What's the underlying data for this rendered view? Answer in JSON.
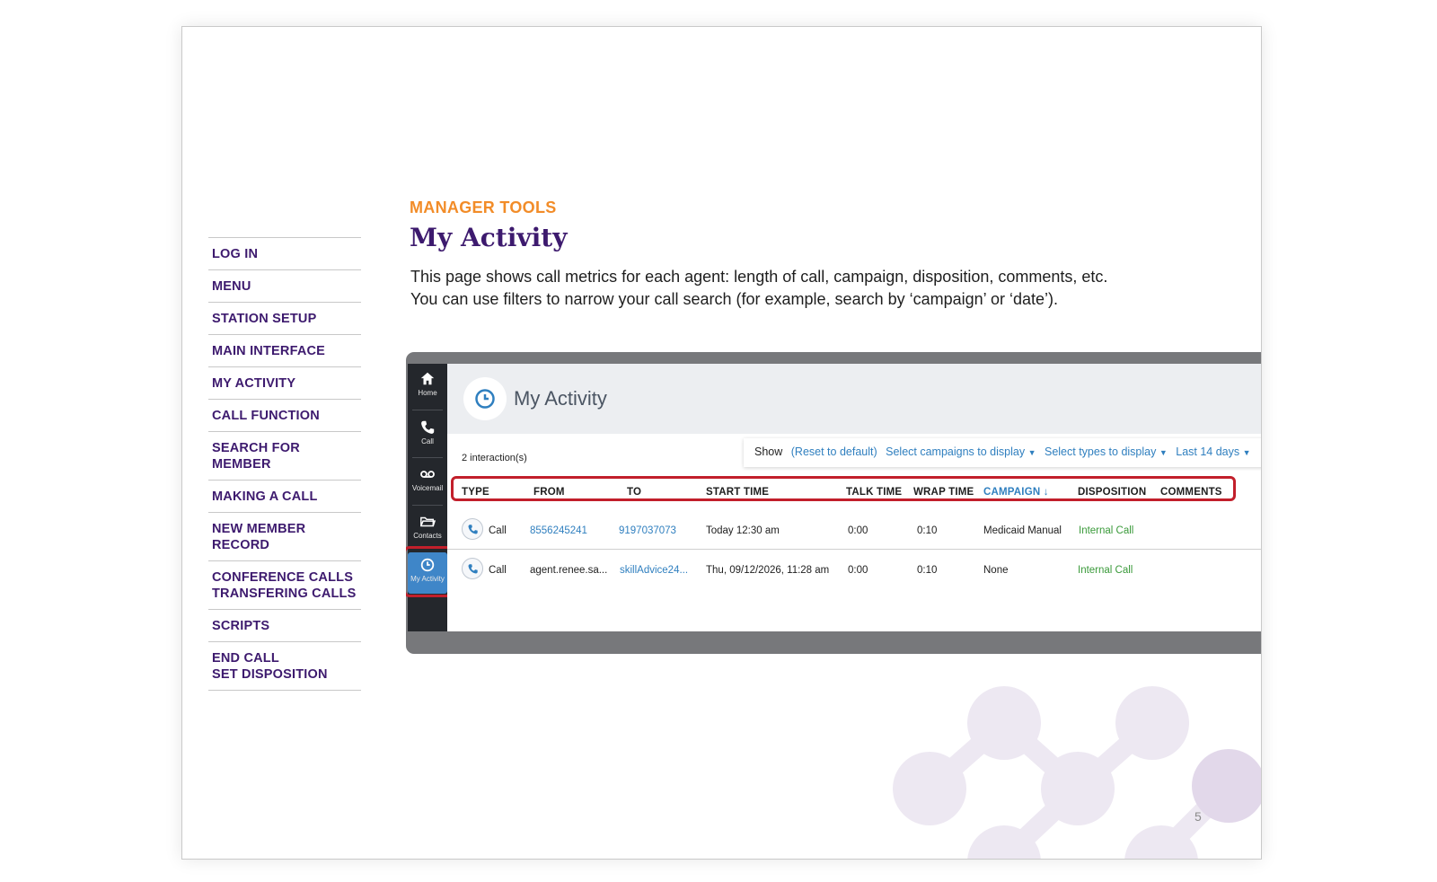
{
  "nav": {
    "items": [
      "LOG IN",
      "MENU",
      "STATION SETUP",
      "MAIN INTERFACE",
      "MY ACTIVITY",
      "CALL FUNCTION",
      "SEARCH FOR MEMBER",
      "MAKING A CALL",
      "NEW MEMBER RECORD",
      "CONFERENCE CALLS\nTRANSFERING CALLS",
      "SCRIPTS",
      "END CALL\nSET DISPOSITION"
    ]
  },
  "header": {
    "kicker": "MANAGER TOOLS",
    "title": "My Activity",
    "desc_line1": "This page shows call metrics for each agent: length of call, campaign, disposition, comments, etc.",
    "desc_line2": "You can use filters to narrow your call search (for example, search by ‘campaign’ or ‘date’)."
  },
  "app": {
    "rail": [
      {
        "label": "Home",
        "icon": "home-icon"
      },
      {
        "label": "Call",
        "icon": "phone-icon"
      },
      {
        "label": "Voicemail",
        "icon": "voicemail-icon"
      },
      {
        "label": "Contacts",
        "icon": "folder-icon"
      },
      {
        "label": "My Activity",
        "icon": "clock-icon",
        "active": true
      }
    ],
    "title": "My Activity",
    "filters": {
      "show": "Show",
      "reset": "(Reset to default)",
      "campaigns": "Select campaigns to display",
      "types": "Select types to display",
      "range": "Last 14 days"
    },
    "count": "2 interaction(s)",
    "columns": [
      "TYPE",
      "FROM",
      "TO",
      "START TIME",
      "TALK TIME",
      "WRAP TIME",
      "CAMPAIGN ↓",
      "DISPOSITION",
      "COMMENTS"
    ],
    "rows": [
      {
        "type": "Call",
        "from": "8556245241",
        "to": "9197037073",
        "start": "Today 12:30 am",
        "talk": "0:00",
        "wrap": "0:10",
        "campaign": "Medicaid Manual",
        "disposition": "Internal Call",
        "comments": ""
      },
      {
        "type": "Call",
        "from": "agent.renee.sa...",
        "to": "skillAdvice24...",
        "start": "Thu, 09/12/2026, 11:28 am",
        "talk": "0:00",
        "wrap": "0:10",
        "campaign": "None",
        "disposition": "Internal Call",
        "comments": ""
      }
    ]
  },
  "page_number": "5",
  "colors": {
    "brand_purple": "#3d1a6e",
    "accent_orange": "#f28c28",
    "highlight_red": "#c21f2b",
    "link_blue": "#2f7fbf",
    "disposition_green": "#3a9a3a"
  }
}
